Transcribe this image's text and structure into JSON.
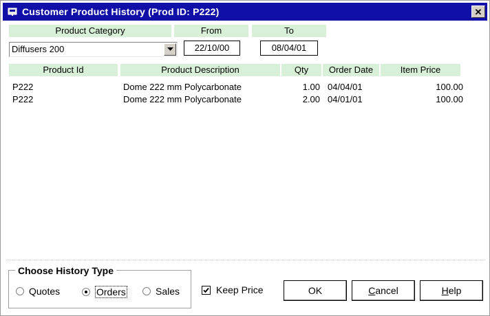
{
  "window": {
    "title": "Customer Product History (Prod ID: P222)",
    "title_bar_color": "#1010a8",
    "close_icon": "close-icon"
  },
  "filters": {
    "category_label": "Product Category",
    "from_label": "From",
    "to_label": "To",
    "category_value": "Diffusers 200",
    "from_value": "22/10/00",
    "to_value": "08/04/01",
    "header_color": "#d8f0d8"
  },
  "table": {
    "columns": [
      "Product Id",
      "Product Description",
      "Qty",
      "Order Date",
      "Item Price"
    ],
    "rows": [
      {
        "id": "P222",
        "desc": "Dome 222 mm Polycarbonate",
        "qty": "1.00",
        "date": "04/04/01",
        "price": "100.00"
      },
      {
        "id": "P222",
        "desc": "Dome 222 mm Polycarbonate",
        "qty": "2.00",
        "date": "04/01/01",
        "price": "100.00"
      }
    ]
  },
  "history_type": {
    "legend": "Choose History Type",
    "options": [
      "Quotes",
      "Orders",
      "Sales"
    ],
    "selected": "Orders"
  },
  "keep_price": {
    "label": "Keep Price",
    "checked": true
  },
  "buttons": {
    "ok": "OK",
    "cancel_underline": "C",
    "cancel_rest": "ancel",
    "help_underline": "H",
    "help_rest": "elp"
  }
}
